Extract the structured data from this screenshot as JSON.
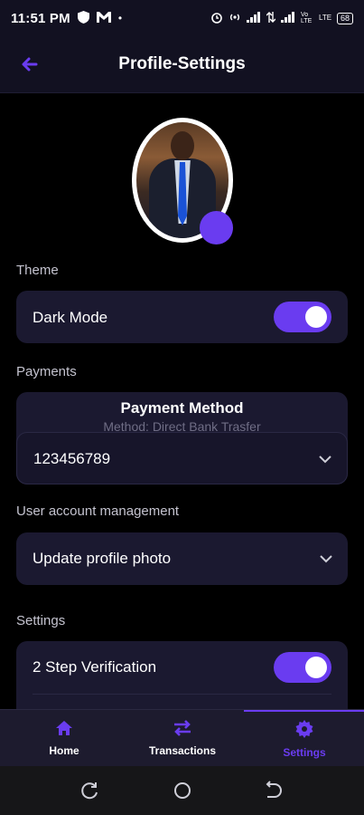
{
  "status_bar": {
    "time": "11:51 PM",
    "network_badges": [
      "Vo LTE",
      "LTE"
    ],
    "battery": "68"
  },
  "header": {
    "title": "Profile-Settings"
  },
  "sections": {
    "theme": {
      "label": "Theme",
      "dark_mode_label": "Dark Mode",
      "dark_mode_on": true
    },
    "payments": {
      "label": "Payments",
      "method_title": "Payment Method",
      "method_subtitle": "Method: Direct Bank Trasfer",
      "account_number": "123456789"
    },
    "user_account": {
      "label": "User account management",
      "update_photo_label": "Update profile photo"
    },
    "settings": {
      "label": "Settings",
      "two_step_label": "2 Step Verification",
      "two_step_on": true
    }
  },
  "bottom_nav": {
    "items": [
      {
        "label": "Home",
        "icon": "home-icon",
        "active": false
      },
      {
        "label": "Transactions",
        "icon": "swap-arrows-icon",
        "active": false
      },
      {
        "label": "Settings",
        "icon": "gear-icon",
        "active": true
      }
    ]
  },
  "colors": {
    "accent": "#6a3cf0",
    "card": "#1b1930",
    "background": "#000000",
    "header": "#121121"
  }
}
